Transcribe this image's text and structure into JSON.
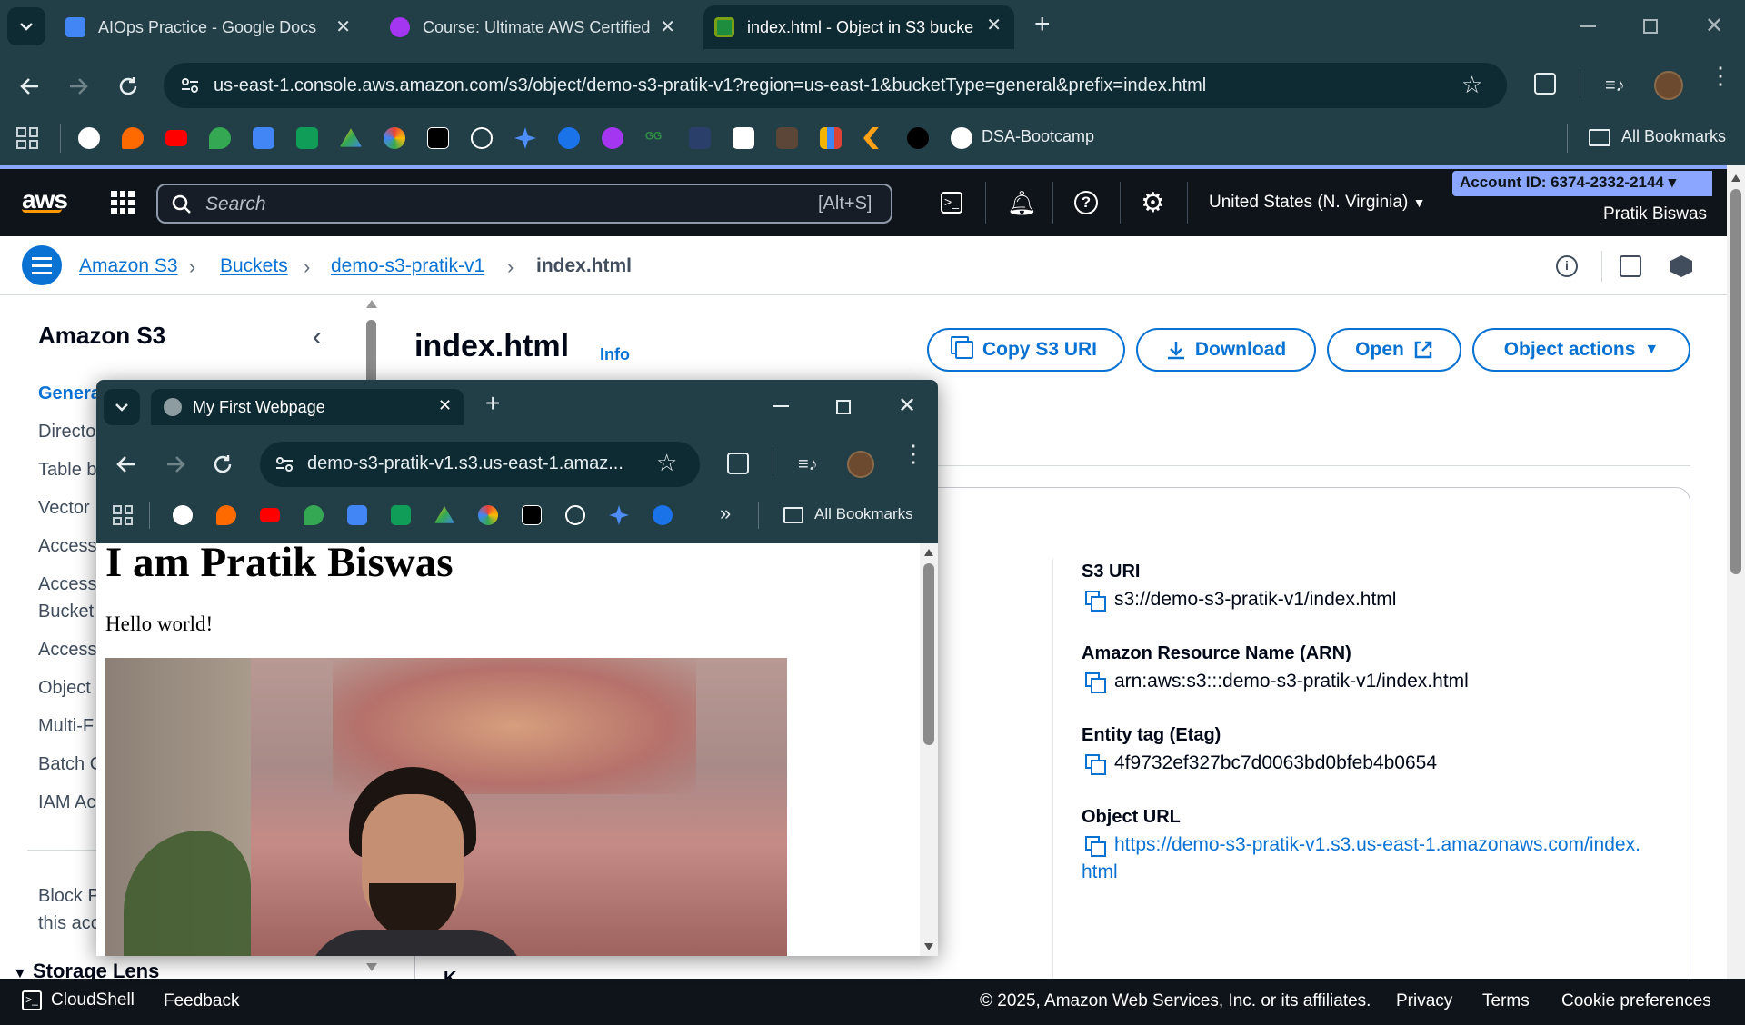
{
  "browser": {
    "tabs": [
      {
        "label": "AIOps Practice - Google Docs",
        "icon": "google-docs-icon"
      },
      {
        "label": "Course: Ultimate AWS Certified",
        "icon": "udemy-icon"
      },
      {
        "label": "index.html - Object in S3 bucke",
        "icon": "aws-s3-icon"
      }
    ],
    "url": "us-east-1.console.aws.amazon.com/s3/object/demo-s3-pratik-v1?region=us-east-1&bucketType=general&prefix=index.html",
    "bookmark_folder": "DSA-Bootcamp",
    "all_bookmarks": "All Bookmarks"
  },
  "aws": {
    "search_placeholder": "Search",
    "search_shortcut": "[Alt+S]",
    "region": "United States (N. Virginia)",
    "account_id": "Account ID: 6374-2332-2144",
    "user": "Pratik Biswas"
  },
  "breadcrumb": [
    "Amazon S3",
    "Buckets",
    "demo-s3-pratik-v1",
    "index.html"
  ],
  "sidebar": {
    "title": "Amazon S3",
    "items": [
      "Genera",
      "Directo",
      "Table b",
      "Vector",
      "Access",
      "Access",
      "Bucket",
      "Access",
      "Object",
      "Multi-F",
      "Batch C",
      "IAM Ac"
    ],
    "block_text": [
      "Block P",
      "this acc"
    ],
    "storage_lens": "Storage Lens"
  },
  "main": {
    "title": "index.html",
    "info": "Info",
    "buttons": {
      "copy_uri": "Copy S3 URI",
      "download": "Download",
      "open": "Open",
      "object_actions": "Object actions"
    },
    "properties": [
      {
        "label": "S3 URI",
        "value": "s3://demo-s3-pratik-v1/index.html"
      },
      {
        "label": "Amazon Resource Name (ARN)",
        "value": "arn:aws:s3:::demo-s3-pratik-v1/index.html"
      },
      {
        "label": "Entity tag (Etag)",
        "value": "4f9732ef327bc7d0063bd0bfeb4b0654"
      },
      {
        "label": "Object URL",
        "value_line1": "https://demo-s3-pratik-v1.s3.us-east-1.amazonaws.com/index.",
        "value_line2": "html"
      }
    ],
    "partial_k": "K"
  },
  "footer": {
    "cloudshell": "CloudShell",
    "feedback": "Feedback",
    "copyright": "© 2025, Amazon Web Services, Inc. or its affiliates.",
    "privacy": "Privacy",
    "terms": "Terms",
    "cookie": "Cookie preferences"
  },
  "popup": {
    "tab_label": "My First Webpage",
    "url": "demo-s3-pratik-v1.s3.us-east-1.amaz...",
    "all_bookmarks": "All Bookmarks",
    "heading": "I am Pratik Biswas",
    "paragraph": "Hello world!"
  },
  "colors": {
    "chrome_bg": "#223e47",
    "aws_nav": "#0f141a",
    "link_blue": "#0972d3",
    "account_badge": "#8aa6ff"
  }
}
